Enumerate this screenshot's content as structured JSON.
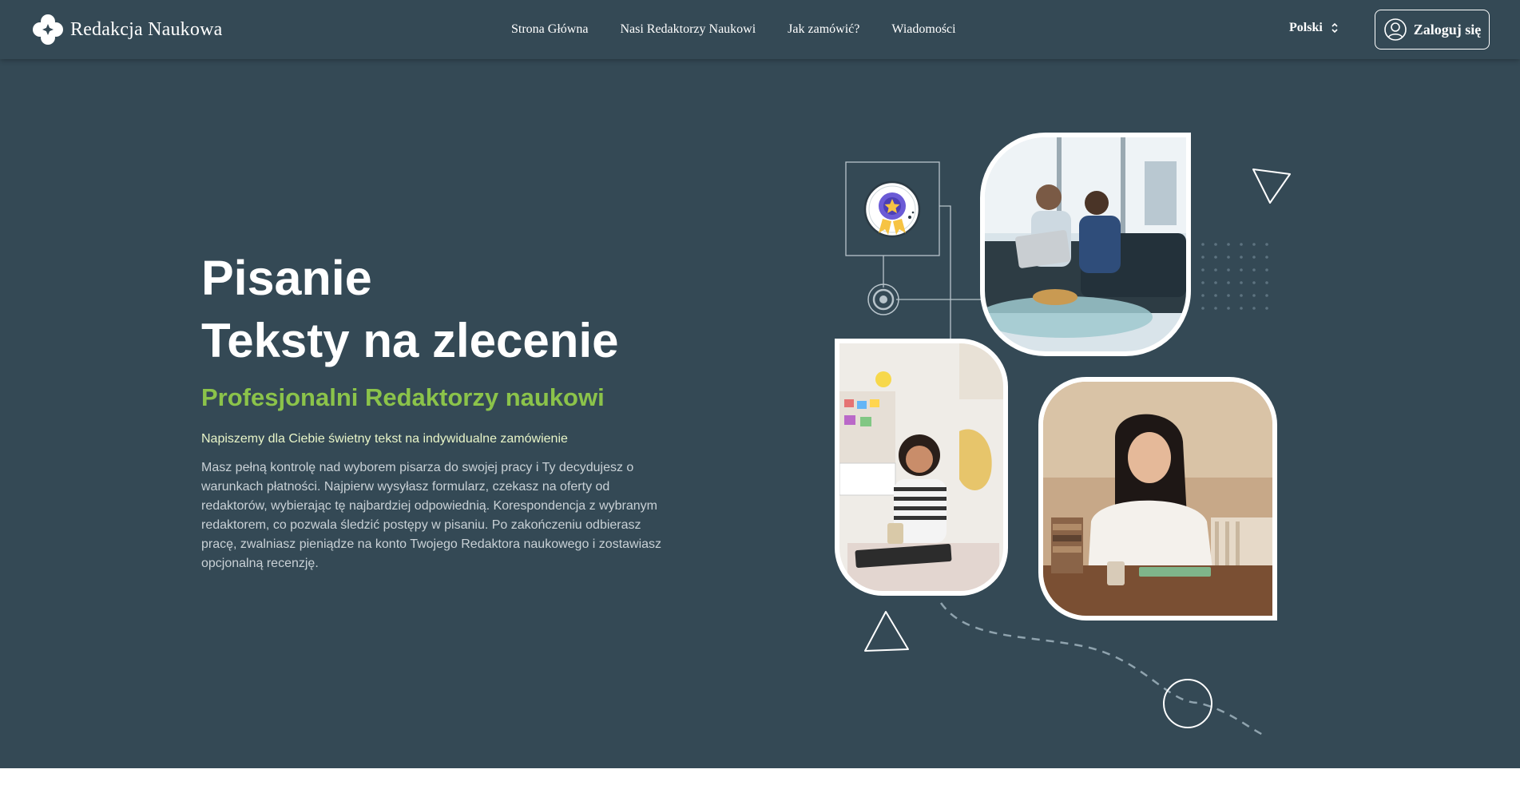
{
  "header": {
    "brand": "Redakcja Naukowa",
    "nav": [
      {
        "label": "Strona Główna"
      },
      {
        "label": "Nasi Redaktorzy Naukowi"
      },
      {
        "label": "Jak zamówić?"
      },
      {
        "label": "Wiadomości"
      }
    ],
    "language": "Polski",
    "login_label": "Zaloguj się"
  },
  "hero": {
    "title": "Pisanie",
    "title2": "Teksty na zlecenie",
    "subtitle": "Profesjonalni Redaktorzy naukowi",
    "lead": "Napiszemy dla Ciebie świetny tekst na indywidualne zamówienie",
    "body": "Masz pełną kontrolę nad wyborem pisarza do swojej pracy i Ty decydujesz o warunkach płatności. Najpierw wysyłasz formularz, czekasz na oferty od redaktorów, wybierając tę najbardziej odpowiednią. Korespondencja z wybranym redaktorem, co pozwala śledzić postępy w pisaniu. Po zakończeniu odbierasz pracę, zwalniasz pieniądze na konto Twojego Redaktora naukowego i zostawiasz opcjonalną recenzję."
  },
  "colors": {
    "background": "#344955",
    "accent_green": "#8bc34a",
    "white": "#ffffff"
  },
  "icons": {
    "logo": "flower-cross-logo",
    "language_toggle": "chevron-up-down-icon",
    "login": "user-circle-icon",
    "badge": "award-badge-icon"
  }
}
